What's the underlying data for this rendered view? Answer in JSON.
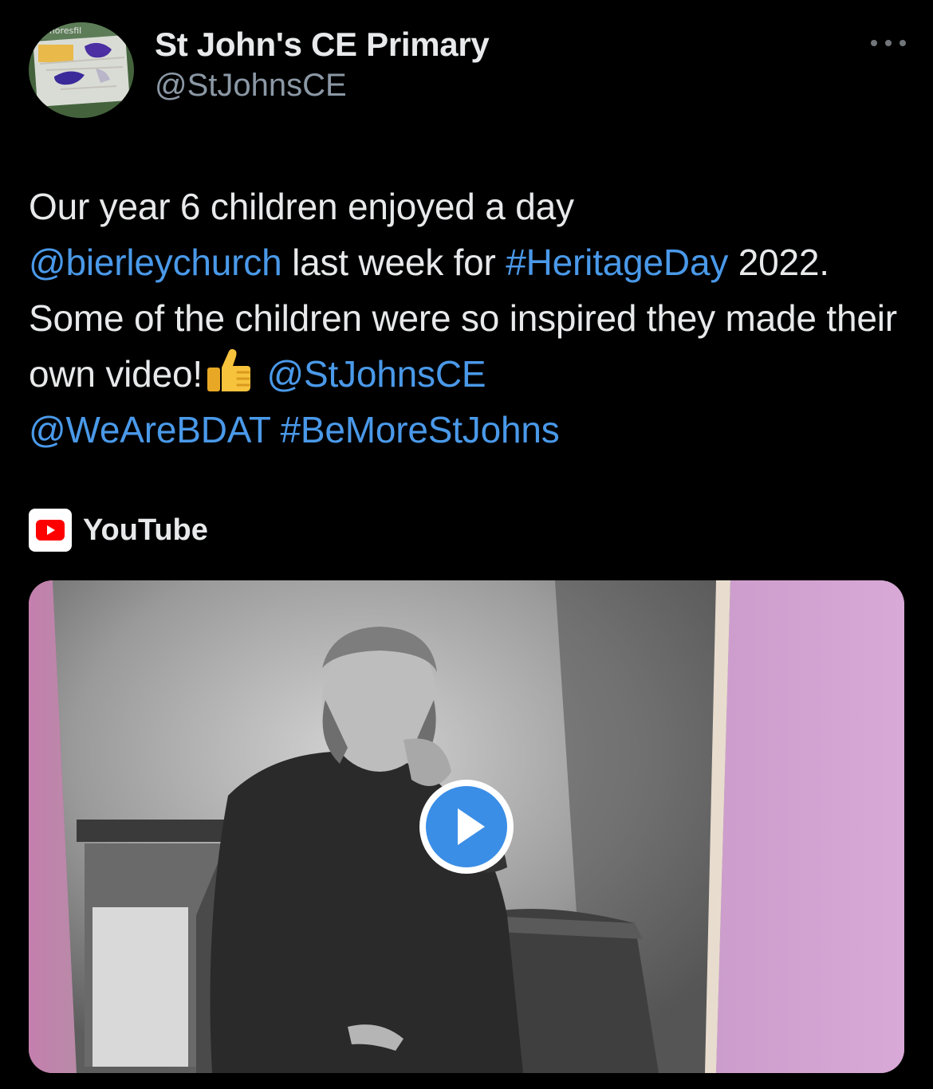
{
  "account": {
    "display_name": "St John's CE Primary",
    "handle": "@StJohnsCE",
    "avatar_text": "moresfil"
  },
  "tweet": {
    "seg1": "Our year 6 children enjoyed a day",
    "mention1": "@bierleychurch",
    "seg2": " last week for ",
    "hashtag1": "#HeritageDay",
    "seg3": "2022. Some of the children were so inspired they made their own video!",
    "mention2": "@StJohnsCE",
    "mention3": "@WeAreBDAT",
    "hashtag2": "#BeMoreStJohns"
  },
  "card": {
    "source_label": "YouTube",
    "source_icon": "youtube-icon",
    "play_icon": "play-icon"
  },
  "icons": {
    "more": "more-dots-icon",
    "reaction": "thumbs-up-icon"
  },
  "colors": {
    "background": "#000000",
    "text": "#e7e9ea",
    "secondary": "#8b98a5",
    "link": "#4a99e9",
    "play": "#3b8ee6",
    "youtube_red": "#ff0000"
  }
}
